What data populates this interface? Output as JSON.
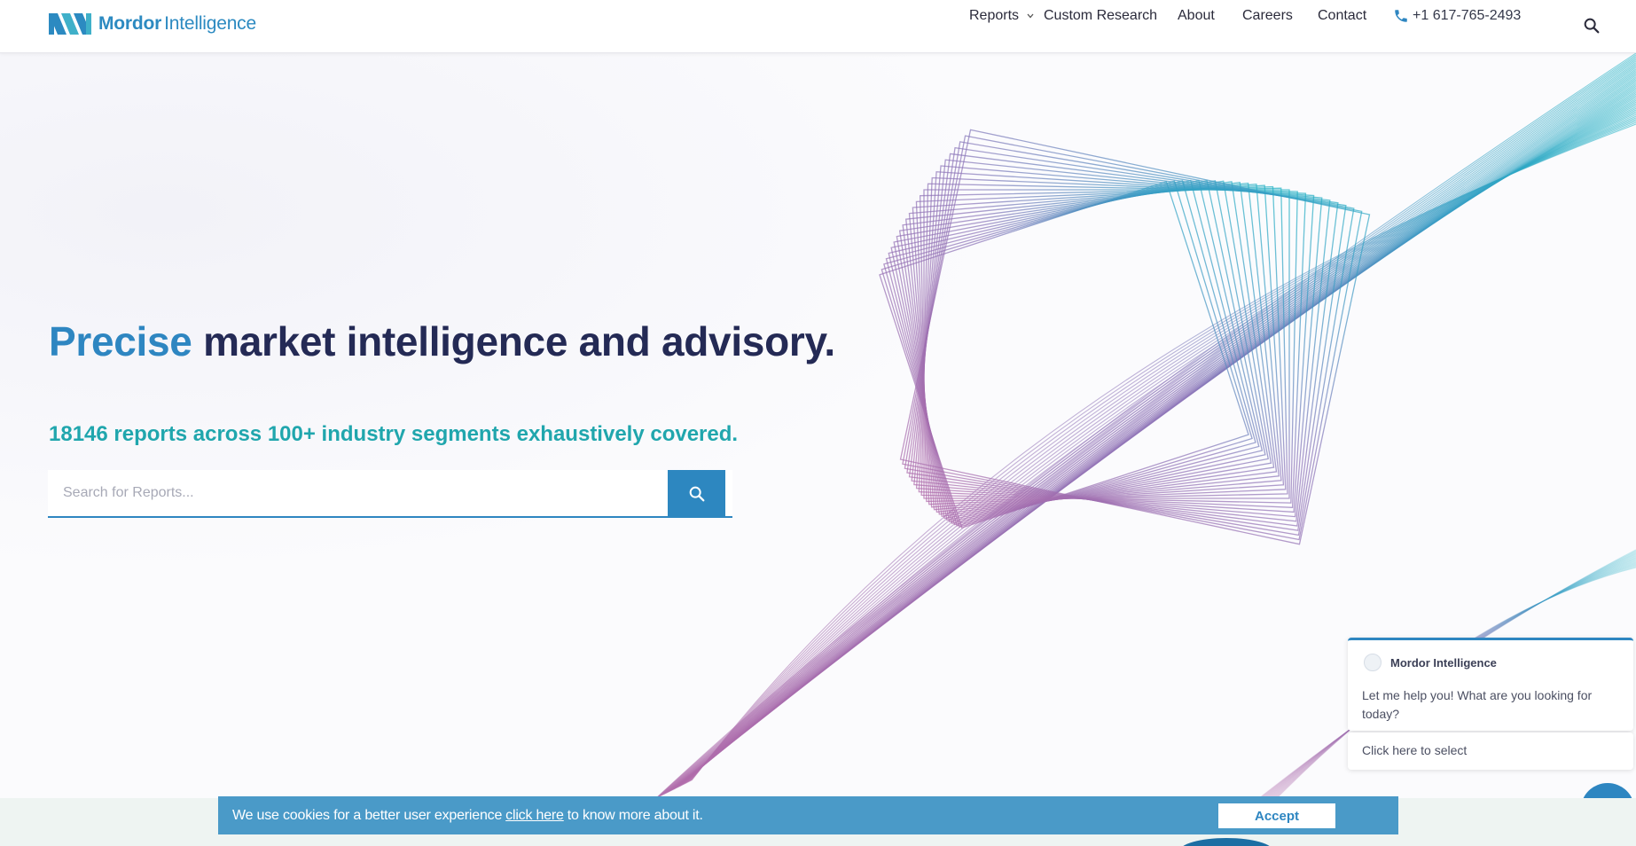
{
  "brand": {
    "name_bold": "Mordor",
    "name_light": "Intelligence",
    "color": "#2c8ac1"
  },
  "nav": {
    "reports": "Reports",
    "custom_research": "Custom Research",
    "about": "About",
    "careers": "Careers",
    "contact": "Contact",
    "phone": "+1 617-765-2493"
  },
  "icons": {
    "reports_dropdown": "chevron-down-icon",
    "phone": "phone-icon",
    "top_search": "search-icon",
    "search_button": "search-icon",
    "chat": "chat-bubble-icon"
  },
  "hero": {
    "headline_accent": "Precise",
    "headline_rest": " market intelligence and advisory.",
    "subline": "18146 reports across 100+ industry segments exhaustively covered.",
    "search_placeholder": "Search for Reports..."
  },
  "chat": {
    "agent_name": "Mordor Intelligence",
    "message": "Let me help you! What are you looking for today?",
    "select_prompt": "Click here to select"
  },
  "cookie": {
    "text_before": "We use cookies for a better user experience",
    "link_text": "click here",
    "text_after": "to know more about it.",
    "accept_label": "Accept"
  },
  "colors": {
    "primary_blue": "#2e86c1",
    "headline_navy": "#242a55",
    "teal": "#20a6ad",
    "cookie_bg": "#4a9ac8",
    "magenta_lines": "#b06aaa",
    "teal_lines": "#27a9c6"
  }
}
